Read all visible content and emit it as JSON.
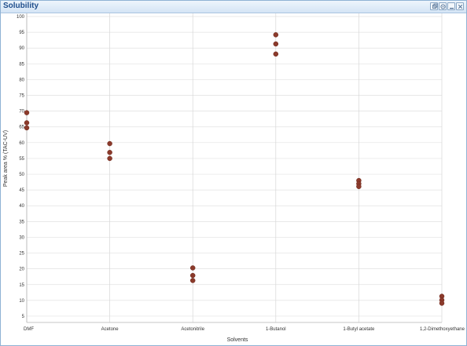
{
  "window": {
    "title": "Solubility",
    "buttons": [
      "restore-icon",
      "settings-icon",
      "minimize-icon",
      "close-icon"
    ]
  },
  "chart_data": {
    "type": "scatter",
    "title": "",
    "xlabel": "Solvents",
    "ylabel": "Peak area % (TAC-UV)",
    "categories": [
      "DMF",
      "Acetone",
      "Acetonitrile",
      "1-Butanol",
      "1-Butyl acetate",
      "1,2-Dimethoxyethane"
    ],
    "ylim": [
      3,
      101
    ],
    "yticks": [
      5,
      10,
      15,
      20,
      25,
      30,
      35,
      40,
      45,
      50,
      55,
      60,
      65,
      70,
      75,
      80,
      85,
      90,
      95,
      100
    ],
    "grid": true,
    "legend": "none",
    "marker_color": "#8b3a2b",
    "series": [
      {
        "points": [
          {
            "x": "DMF",
            "y": 69.5
          },
          {
            "x": "DMF",
            "y": 66.3
          },
          {
            "x": "DMF",
            "y": 64.7
          },
          {
            "x": "Acetone",
            "y": 59.7
          },
          {
            "x": "Acetone",
            "y": 56.9
          },
          {
            "x": "Acetone",
            "y": 55.0
          },
          {
            "x": "Acetonitrile",
            "y": 20.3
          },
          {
            "x": "Acetonitrile",
            "y": 17.9
          },
          {
            "x": "Acetonitrile",
            "y": 16.3
          },
          {
            "x": "1-Butanol",
            "y": 94.2
          },
          {
            "x": "1-Butanol",
            "y": 91.3
          },
          {
            "x": "1-Butanol",
            "y": 88.1
          },
          {
            "x": "1-Butyl acetate",
            "y": 48.0
          },
          {
            "x": "1-Butyl acetate",
            "y": 47.0
          },
          {
            "x": "1-Butyl acetate",
            "y": 46.1
          },
          {
            "x": "1,2-Dimethoxyethane",
            "y": 11.3
          },
          {
            "x": "1,2-Dimethoxyethane",
            "y": 10.1
          },
          {
            "x": "1,2-Dimethoxyethane",
            "y": 9.1
          }
        ]
      }
    ]
  }
}
